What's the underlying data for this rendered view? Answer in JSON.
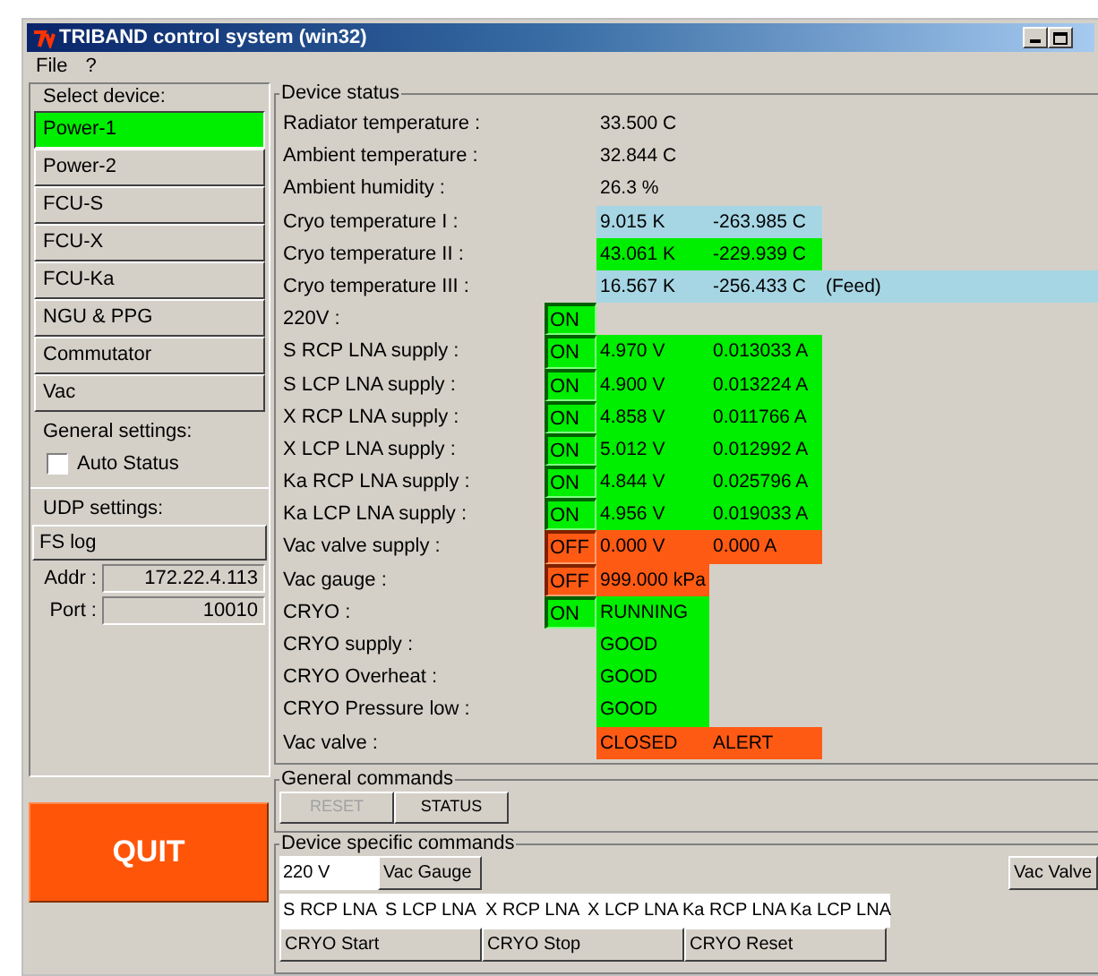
{
  "window": {
    "title": "TRIBAND control system (win32)"
  },
  "menu": [
    "File",
    "?"
  ],
  "sidebar": {
    "select_label": "Select device:",
    "devices": [
      {
        "label": "Power-1",
        "selected": true
      },
      {
        "label": "Power-2",
        "selected": false
      },
      {
        "label": "FCU-S",
        "selected": false
      },
      {
        "label": "FCU-X",
        "selected": false
      },
      {
        "label": "FCU-Ka",
        "selected": false
      },
      {
        "label": "NGU & PPG",
        "selected": false
      },
      {
        "label": "Commutator",
        "selected": false
      },
      {
        "label": "Vac",
        "selected": false
      }
    ],
    "general_label": "General settings:",
    "auto_status": {
      "label": "Auto Status",
      "checked": false
    },
    "udp_label": "UDP settings:",
    "fs_log": "FS log",
    "addr": {
      "label": "Addr :",
      "value": "172.22.4.113"
    },
    "port": {
      "label": "Port :",
      "value": "10010"
    },
    "quit": "QUIT"
  },
  "device_status": {
    "title": "Device status",
    "rows": [
      {
        "label": "Radiator temperature :",
        "cells": [
          {
            "text": "33.500 C"
          }
        ]
      },
      {
        "label": "Ambient temperature :",
        "cells": [
          {
            "text": "32.844 C"
          }
        ]
      },
      {
        "label": "Ambient humidity :",
        "cells": [
          {
            "text": "26.3 %"
          }
        ]
      },
      {
        "label": "Cryo temperature I :",
        "cells": [
          {
            "text": "9.015 K",
            "color": "#a6d6e4"
          },
          {
            "text": "-263.985 C",
            "color": "#a6d6e4"
          }
        ]
      },
      {
        "label": "Cryo temperature II :",
        "cells": [
          {
            "text": "43.061 K",
            "color": "#00ee00"
          },
          {
            "text": "-229.939 C",
            "color": "#00ee00"
          }
        ]
      },
      {
        "label": "Cryo temperature III :",
        "cells": [
          {
            "text": "16.567 K",
            "color": "#a6d6e4"
          },
          {
            "text": "-256.433 C",
            "color": "#a6d6e4"
          },
          {
            "text": "(Feed)",
            "color": "#a6d6e4"
          }
        ]
      },
      {
        "label": "220V :",
        "switch": {
          "text": "ON",
          "on": true
        },
        "cells": []
      },
      {
        "label": "S RCP LNA supply :",
        "switch": {
          "text": "ON",
          "on": true
        },
        "cells": [
          {
            "text": "4.970 V",
            "color": "#00ee00"
          },
          {
            "text": "0.013033 A",
            "color": "#00ee00"
          }
        ]
      },
      {
        "label": "S LCP LNA supply :",
        "switch": {
          "text": "ON",
          "on": true
        },
        "cells": [
          {
            "text": "4.900 V",
            "color": "#00ee00"
          },
          {
            "text": "0.013224 A",
            "color": "#00ee00"
          }
        ]
      },
      {
        "label": "X RCP LNA supply :",
        "switch": {
          "text": "ON",
          "on": true
        },
        "cells": [
          {
            "text": "4.858 V",
            "color": "#00ee00"
          },
          {
            "text": "0.011766 A",
            "color": "#00ee00"
          }
        ]
      },
      {
        "label": "X LCP LNA supply :",
        "switch": {
          "text": "ON",
          "on": true
        },
        "cells": [
          {
            "text": "5.012 V",
            "color": "#00ee00"
          },
          {
            "text": "0.012992 A",
            "color": "#00ee00"
          }
        ]
      },
      {
        "label": "Ka RCP LNA supply :",
        "switch": {
          "text": "ON",
          "on": true
        },
        "cells": [
          {
            "text": "4.844 V",
            "color": "#00ee00"
          },
          {
            "text": "0.025796 A",
            "color": "#00ee00"
          }
        ]
      },
      {
        "label": "Ka LCP LNA supply :",
        "switch": {
          "text": "ON",
          "on": true
        },
        "cells": [
          {
            "text": "4.956 V",
            "color": "#00ee00"
          },
          {
            "text": "0.019033 A",
            "color": "#00ee00"
          }
        ]
      },
      {
        "label": "Vac valve supply :",
        "switch": {
          "text": "OFF",
          "on": false
        },
        "cells": [
          {
            "text": "0.000 V",
            "color": "#ff5a14"
          },
          {
            "text": "0.000 A",
            "color": "#ff5a14"
          }
        ]
      },
      {
        "label": "Vac gauge :",
        "switch": {
          "text": "OFF",
          "on": false
        },
        "cells": [
          {
            "text": "999.000 kPa",
            "color": "#ff5a14"
          }
        ]
      },
      {
        "label": "CRYO :",
        "switch": {
          "text": "ON",
          "on": true
        },
        "cells": [
          {
            "text": "RUNNING",
            "color": "#00ee00"
          }
        ]
      },
      {
        "label": "CRYO supply :",
        "cells": [
          {
            "text": "GOOD",
            "color": "#00ee00"
          }
        ]
      },
      {
        "label": "CRYO Overheat :",
        "cells": [
          {
            "text": "GOOD",
            "color": "#00ee00"
          }
        ]
      },
      {
        "label": "CRYO Pressure low :",
        "cells": [
          {
            "text": "GOOD",
            "color": "#00ee00"
          }
        ]
      },
      {
        "label": "Vac valve :",
        "cells": [
          {
            "text": "CLOSED",
            "color": "#ff5a14"
          },
          {
            "text": "ALERT",
            "color": "#ff5a14"
          }
        ]
      }
    ]
  },
  "general_commands": {
    "title": "General commands",
    "buttons": [
      {
        "label": "RESET",
        "disabled": true
      },
      {
        "label": "STATUS",
        "disabled": false
      }
    ]
  },
  "device_commands": {
    "title": "Device specific commands",
    "row_1": [
      {
        "label": "220 V",
        "active": true
      },
      {
        "label": "Vac Gauge",
        "active": false
      }
    ],
    "vac_valve": {
      "label": "Vac Valve",
      "active": false
    },
    "row_2": [
      {
        "label": "S RCP LNA",
        "active": true
      },
      {
        "label": "S LCP LNA",
        "active": true
      },
      {
        "label": "X RCP LNA",
        "active": true
      },
      {
        "label": "X LCP LNA",
        "active": true
      },
      {
        "label": "Ka RCP LNA",
        "active": true
      },
      {
        "label": "Ka LCP LNA",
        "active": true
      }
    ],
    "row_3": [
      {
        "label": "CRYO Start",
        "active": false
      },
      {
        "label": "CRYO Stop",
        "active": false
      },
      {
        "label": "CRYO Reset",
        "active": false
      }
    ]
  }
}
